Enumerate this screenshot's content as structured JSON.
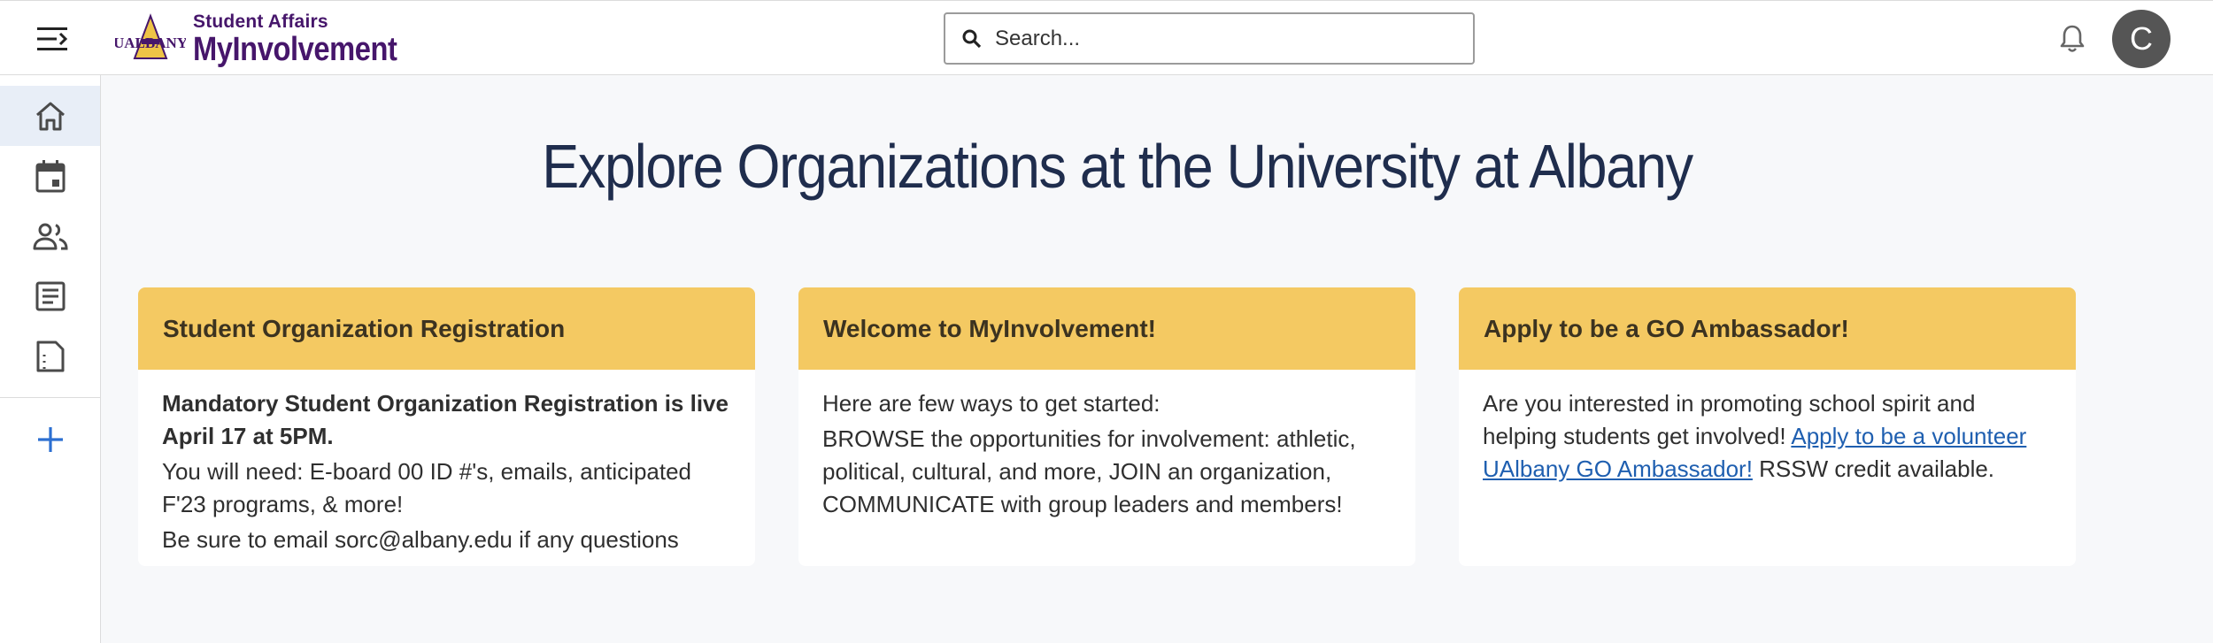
{
  "header": {
    "logo_sub": "Student Affairs",
    "logo_main": "MyInvolvement",
    "logo_mark": "UALBANY",
    "search_placeholder": "Search...",
    "avatar_letter": "C"
  },
  "sidebar": {
    "items": [
      {
        "name": "home",
        "icon": "home-icon",
        "active": true
      },
      {
        "name": "events",
        "icon": "calendar-icon",
        "active": false
      },
      {
        "name": "organizations",
        "icon": "people-icon",
        "active": false
      },
      {
        "name": "news",
        "icon": "article-icon",
        "active": false
      },
      {
        "name": "forms",
        "icon": "document-icon",
        "active": false
      }
    ],
    "add_icon": "plus-icon"
  },
  "main": {
    "title": "Explore Organizations at the University at Albany",
    "cards": [
      {
        "heading": "Student Organization Registration",
        "bold_line": "Mandatory Student Organization Registration is live April 17 at 5PM.",
        "line2": "You will need: E-board 00 ID #'s, emails, anticipated F'23 programs, & more!",
        "line3": "Be sure to email sorc@albany.edu if any questions"
      },
      {
        "heading": "Welcome to MyInvolvement!",
        "line1": "Here are few ways to get started:",
        "line2": "BROWSE the opportunities for involvement: athletic, political, cultural, and more, JOIN an organization, COMMUNICATE with group leaders and members!"
      },
      {
        "heading": "Apply to be a GO Ambassador!",
        "text_before": "Are you interested in promoting school spirit and helping students get involved! ",
        "link": "Apply to be a volunteer UAlbany GO Ambassador!",
        "text_after": " RSSW credit available."
      }
    ]
  },
  "colors": {
    "brand_purple": "#46166b",
    "card_header": "#f4c962",
    "title": "#1f2d4d",
    "link": "#1f5fb0",
    "sidebar_icon": "#4a4a4a",
    "add_icon": "#2c6fd1"
  }
}
